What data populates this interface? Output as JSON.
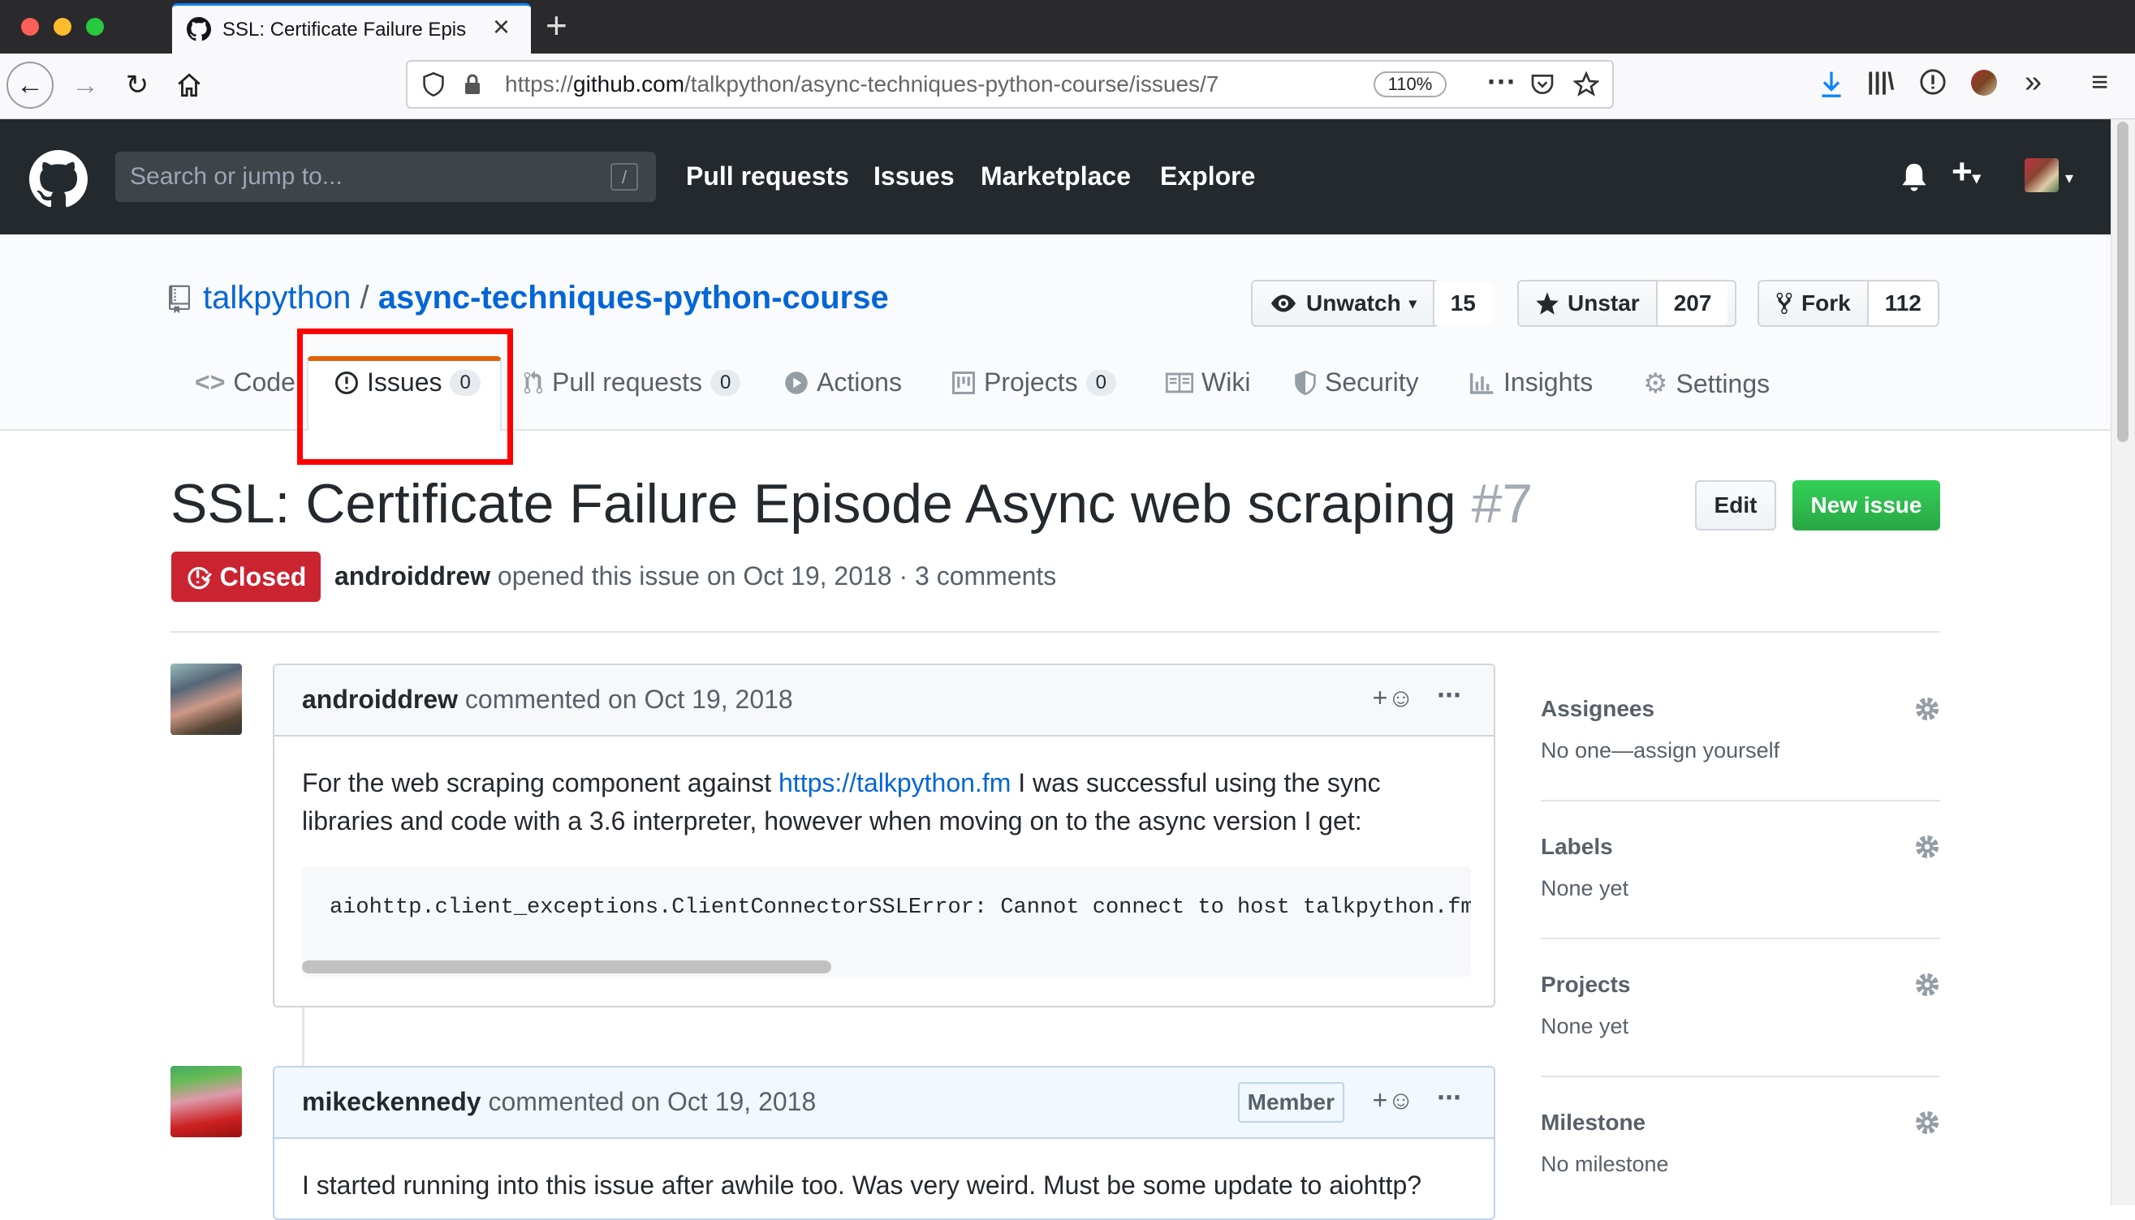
{
  "browser": {
    "tab_title": "SSL: Certificate Failure Episode",
    "url_scheme": "https://",
    "url_host": "github.com",
    "url_path": "/talkpython/async-techniques-python-course/issues/7",
    "zoom": "110%"
  },
  "gh_header": {
    "search_placeholder": "Search or jump to...",
    "search_shortcut": "/",
    "nav": [
      "Pull requests",
      "Issues",
      "Marketplace",
      "Explore"
    ]
  },
  "repo": {
    "owner": "talkpython",
    "separator": "/",
    "name": "async-techniques-python-course",
    "watch": {
      "label": "Unwatch",
      "count": "15"
    },
    "star": {
      "label": "Unstar",
      "count": "207"
    },
    "fork": {
      "label": "Fork",
      "count": "112"
    },
    "tabs": [
      {
        "label": "Code"
      },
      {
        "label": "Issues",
        "count": "0"
      },
      {
        "label": "Pull requests",
        "count": "0"
      },
      {
        "label": "Actions"
      },
      {
        "label": "Projects",
        "count": "0"
      },
      {
        "label": "Wiki"
      },
      {
        "label": "Security"
      },
      {
        "label": "Insights"
      },
      {
        "label": "Settings"
      }
    ]
  },
  "issue": {
    "title": "SSL: Certificate Failure Episode Async web scraping",
    "number": "#7",
    "edit_label": "Edit",
    "new_issue_label": "New issue",
    "state": "Closed",
    "author": "androiddrew",
    "meta": " opened this issue on Oct 19, 2018 · 3 comments"
  },
  "comments": [
    {
      "author": "androiddrew",
      "action": " commented on Oct 19, 2018",
      "body_before": "For the web scraping component against ",
      "link": "https://talkpython.fm",
      "body_after": " I was successful using the sync libraries and code with a 3.6 interpreter, however when moving on to the async version I get:",
      "code": "aiohttp.client_exceptions.ClientConnectorSSLError: Cannot connect to host talkpython.fm:"
    },
    {
      "author": "mikeckennedy",
      "action": " commented on Oct 19, 2018",
      "badge": "Member",
      "body": "I started running into this issue after awhile too. Was very weird. Must be some update to aiohttp?"
    }
  ],
  "sidebar": [
    {
      "heading": "Assignees",
      "value": "No one—assign yourself"
    },
    {
      "heading": "Labels",
      "value": "None yet"
    },
    {
      "heading": "Projects",
      "value": "None yet"
    },
    {
      "heading": "Milestone",
      "value": "No milestone"
    }
  ],
  "colors": {
    "gh_header_bg": "#24292e",
    "link_blue": "#0366d6",
    "closed_red": "#cb2431",
    "new_issue_green": "#28a745",
    "highlight_red": "#ff0000",
    "active_tab_orange": "#e36209"
  }
}
